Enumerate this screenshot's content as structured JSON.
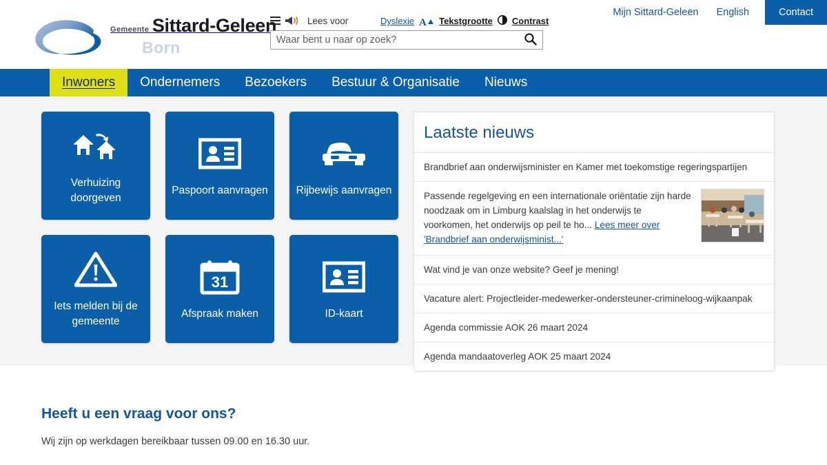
{
  "brand": {
    "gemeente": "Gemeente",
    "name": "Sittard-Geleen",
    "watermark": "Born",
    "colors": {
      "blue": "#0b5ea8",
      "link_blue": "#15559a",
      "yellow": "#dfe017",
      "gray_bg": "#f4f4f4"
    }
  },
  "toolbar": {
    "menu_icon": "hamburger-icon",
    "speaker_icon": "speaker-icon",
    "read_aloud_label": "Lees voor",
    "dyslexia_label": "Dyslexie",
    "textsize_icon": "text-size-icon",
    "textsize_label": "Tekstgrootte",
    "contrast_icon": "contrast-icon",
    "contrast_label": "Contrast"
  },
  "search": {
    "placeholder": "Waar bent u naar op zoek?",
    "value": "",
    "button_icon": "search-icon"
  },
  "top_links": [
    {
      "label": "Mijn Sittard-Geleen",
      "style": "link"
    },
    {
      "label": "English",
      "style": "link"
    },
    {
      "label": "Contact",
      "style": "button"
    }
  ],
  "nav": {
    "items": [
      {
        "label": "Inwoners",
        "active": true
      },
      {
        "label": "Ondernemers",
        "active": false
      },
      {
        "label": "Bezoekers",
        "active": false
      },
      {
        "label": "Bestuur & Organisatie",
        "active": false
      },
      {
        "label": "Nieuws",
        "active": false
      }
    ]
  },
  "tiles": [
    {
      "label": "Verhuizing doorgeven",
      "icon": "moving-houses-icon"
    },
    {
      "label": "Paspoort aanvragen",
      "icon": "id-card-icon"
    },
    {
      "label": "Rijbewijs aanvragen",
      "icon": "car-icon"
    },
    {
      "label": "Iets melden bij de gemeente",
      "icon": "warning-triangle-icon"
    },
    {
      "label": "Afspraak maken",
      "icon": "calendar-31-icon"
    },
    {
      "label": "ID-kaart",
      "icon": "id-card-icon"
    }
  ],
  "news": {
    "title": "Laatste nieuws",
    "items": [
      {
        "type": "plain",
        "text": "Brandbrief aan onderwijsminister en Kamer met toekomstige regeringspartijen"
      },
      {
        "type": "featured",
        "text": "Passende regelgeving en een internationale oriëntatie zijn harde noodzaak om in Limburg kaalslag in het onderwijs te voorkomen, het onderwijs op peil te ho...",
        "link": "Lees meer over 'Brandbrief aan onderwijsminist...'",
        "image": "classroom-photo"
      },
      {
        "type": "plain",
        "text": "Wat vind je van onze website? Geef je mening!"
      },
      {
        "type": "plain",
        "text": "Vacature alert: Projectleider-medewerker-ondersteuner-crimineloog-wijkaanpak"
      },
      {
        "type": "plain",
        "text": "Agenda commissie AOK 26 maart 2024"
      },
      {
        "type": "plain",
        "text": "Agenda mandaatoverleg AOK 25 maart 2024"
      }
    ]
  },
  "bottom": {
    "title": "Heeft u een vraag voor ons?",
    "text": "Wij zijn op werkdagen bereikbaar tussen 09.00 en 16.30 uur."
  }
}
